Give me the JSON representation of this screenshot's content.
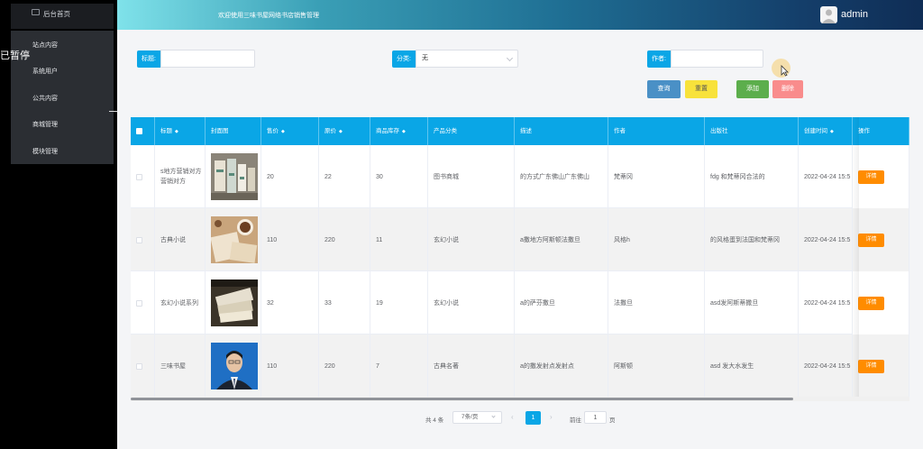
{
  "header": {
    "title": "欢迎使用三味书屋网络书店销售管理",
    "user": "admin"
  },
  "sidebar": {
    "home_label": "后台首页",
    "overlay_label": "已暂停",
    "items": [
      {
        "label": "站点内容"
      },
      {
        "label": "系统用户"
      },
      {
        "label": "公共内容"
      },
      {
        "label": "商城管理"
      },
      {
        "label": "模块管理"
      }
    ]
  },
  "search": {
    "title_label": "标题:",
    "title_value": "",
    "category_label": "分类:",
    "category_value": "无",
    "author_label": "作者:",
    "author_value": ""
  },
  "buttons": {
    "query": "查询",
    "reset": "重置",
    "add": "添加",
    "delete": "删除"
  },
  "table": {
    "columns": [
      "标题",
      "封面图",
      "售价",
      "原价",
      "商品库存",
      "产品分类",
      "描述",
      "作者",
      "出版社",
      "创建时间",
      "操作"
    ],
    "rows": [
      {
        "title": "s地方营销对方营销对方",
        "price": "20",
        "original_price": "22",
        "stock": "30",
        "category": "图书商城",
        "description": "的方式广东佛山广东佛山",
        "author": "梵蒂冈",
        "publisher": "fdg 和梵蒂冈合法的",
        "created": "2022-04-24 15:5",
        "action": "详情"
      },
      {
        "title": "古典小说",
        "price": "110",
        "original_price": "220",
        "stock": "11",
        "category": "玄幻小说",
        "description": "a撒地方阿斯顿法撒旦",
        "author": "风格h",
        "publisher": "的风格蛋到法国和梵蒂冈",
        "created": "2022-04-24 15:5",
        "action": "详情"
      },
      {
        "title": "玄幻小说系列",
        "price": "32",
        "original_price": "33",
        "stock": "19",
        "category": "玄幻小说",
        "description": "a的萨芬撒旦",
        "author": "法撒旦",
        "publisher": "asd发阿斯蒂撒旦",
        "created": "2022-04-24 15:5",
        "action": "详情"
      },
      {
        "title": "三味书屋",
        "price": "110",
        "original_price": "220",
        "stock": "7",
        "category": "古典名著",
        "description": "a的撒发射点发射点",
        "author": "阿斯顿",
        "publisher": "asd 发大水发生",
        "created": "2022-04-24 15:5",
        "action": "详情"
      }
    ]
  },
  "pagination": {
    "total": "共 4 条",
    "page_size": "7条/页",
    "current": "1",
    "goto_label": "前往",
    "goto_value": "1",
    "page_suffix": "页"
  },
  "colors": {
    "accent": "#0aa6e6",
    "query_button": "#3a8ee6",
    "reset_button": "#f8e23b",
    "add_button": "#5cb85c",
    "delete_button": "#f98c8c",
    "detail_button": "#ff8c00"
  }
}
